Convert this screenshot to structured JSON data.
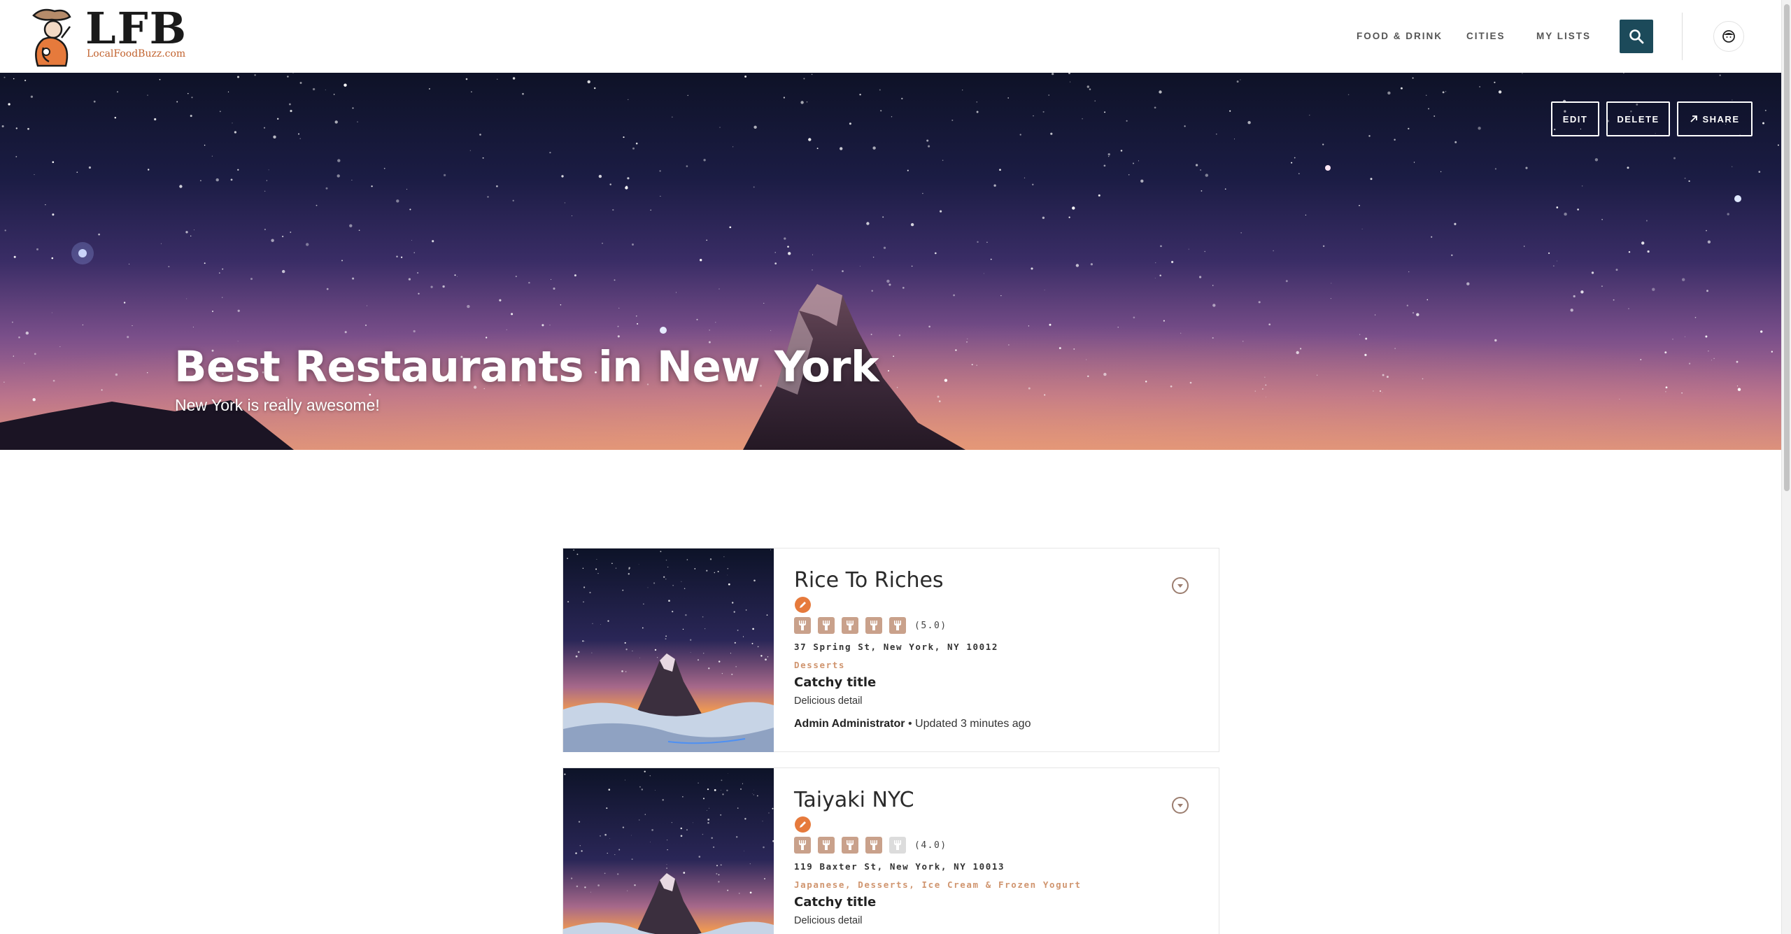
{
  "header": {
    "logo_text": "LFB",
    "logo_subtitle": "LocalFoodBuzz.com",
    "nav": {
      "food_drink": "FOOD & DRINK",
      "cities": "CITIES",
      "my_lists": "MY LISTS"
    },
    "search_icon": "search-icon",
    "avatar_icon": "user-avatar-icon"
  },
  "hero": {
    "title": "Best Restaurants in New York",
    "subtitle": "New York is really awesome!",
    "buttons": {
      "edit": "EDIT",
      "delete": "DELETE",
      "share": "SHARE"
    }
  },
  "restaurants": [
    {
      "name": "Rice To Riches",
      "rating": 5,
      "rating_max": 5,
      "rating_label": "(5.0)",
      "address": "37 Spring St, New York, NY 10012",
      "categories": "Desserts",
      "catchy_title": "Catchy title",
      "detail": "Delicious detail",
      "author": "Admin Administrator",
      "updated": " • Updated 3 minutes ago"
    },
    {
      "name": "Taiyaki NYC",
      "rating": 4,
      "rating_max": 5,
      "rating_label": "(4.0)",
      "address": "119 Baxter St, New York, NY 10013",
      "categories": "Japanese, Desserts, Ice Cream & Frozen Yogurt",
      "catchy_title": "Catchy title",
      "detail": "Delicious detail"
    }
  ],
  "colors": {
    "accent": "#1c4a5a",
    "brand_orange": "#e67a3c",
    "category_text": "#d0956f",
    "fork_filled": "#c9a18b",
    "fork_empty": "#dcdcdc"
  }
}
